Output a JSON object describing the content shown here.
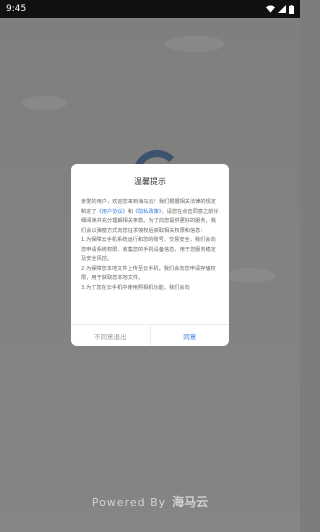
{
  "status_bar": {
    "time": "9:45"
  },
  "footer": {
    "powered_by": "Powered By",
    "brand": "海马云"
  },
  "dialog": {
    "title": "温馨提示",
    "body": {
      "p1_before_links": "亲爱的用户，欢迎您来到海马云！我们根据相关法律的规定制定了",
      "user_agreement_link": "《用户协议》",
      "and_text": "和",
      "privacy_policy_link": "《隐私政策》",
      "p1_after_links": "，请您在点击同意之前仔细阅读并充分理解相关条款。为了向您提供更好的服务，我们会以弹窗方式向您征求授权后获取相关权限和信息：",
      "item1": "1.为保障云手机系统运行和您的账号、交易安全，我们会向您申请系统权限、收集您的手机设备信息，用于您服务稳定及安全风控。",
      "item2": "2.为保障您本地文件上传至云手机，我们会向您申请存储权限，用于获取您本地文件。",
      "item3": "3.为了您在云手机中使用照相机功能，我们会向"
    },
    "disagree_label": "不同意退出",
    "agree_label": "同意"
  }
}
